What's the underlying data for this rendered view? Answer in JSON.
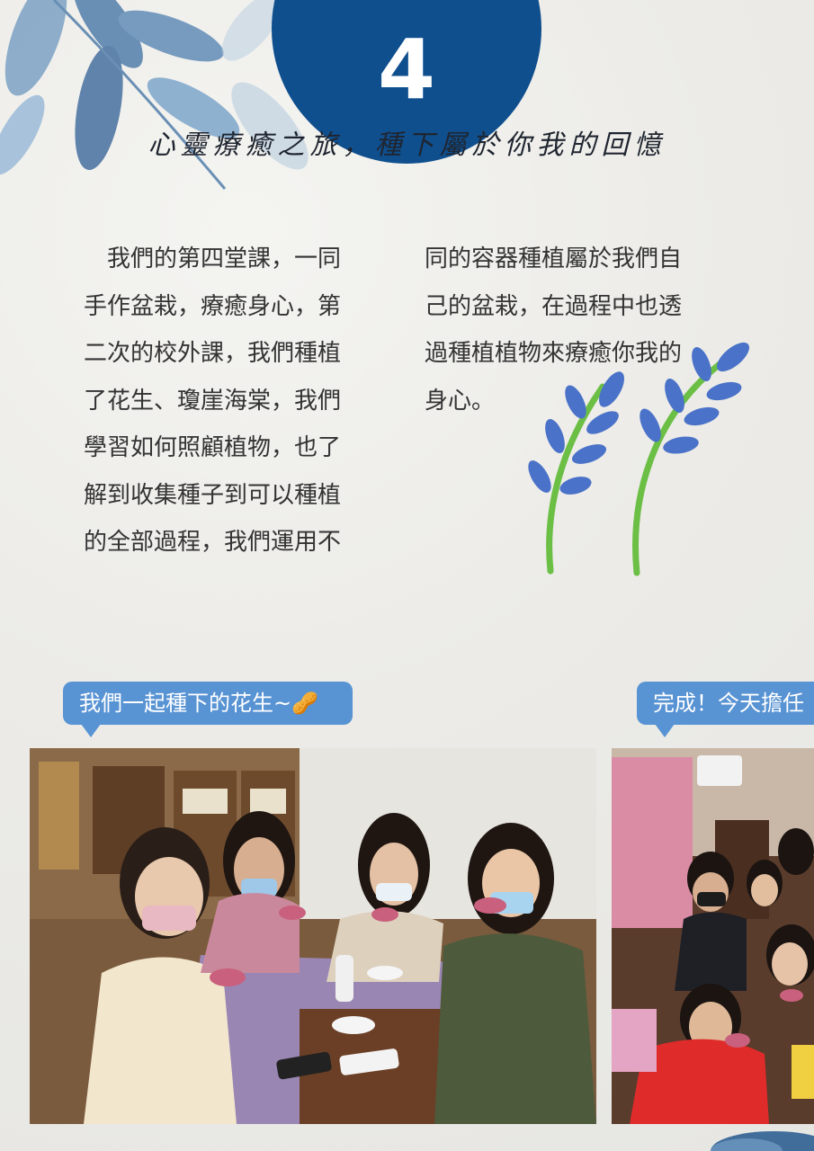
{
  "badge": {
    "number": "4"
  },
  "subtitle": "心靈療癒之旅，種下屬於你我的回憶",
  "article": {
    "left_lines": [
      "　我們的第四堂課，一同",
      "手作盆栽，療癒身心，第",
      "二次的校外課，我們種植",
      "了花生、瓊崖海棠，我們",
      "學習如何照顧植物，也了",
      "解到收集種子到可以種植",
      "的全部過程，我們運用不"
    ],
    "right_lines": [
      "同的容器種植屬於我們自",
      "己的盆栽，在過程中也透",
      "過種植植物來療癒你我的",
      "身心。"
    ]
  },
  "captions": {
    "photo1": "我們一起種下的花生~🥜",
    "photo2": "完成！今天擔任"
  },
  "colors": {
    "badge": "#0f4f8e",
    "bubble": "#5893d3",
    "stem": "#6bbf45",
    "petal": "#4a72c8"
  },
  "icons": [
    "leaf-branch-illustration",
    "flower-sprig-illustration"
  ]
}
